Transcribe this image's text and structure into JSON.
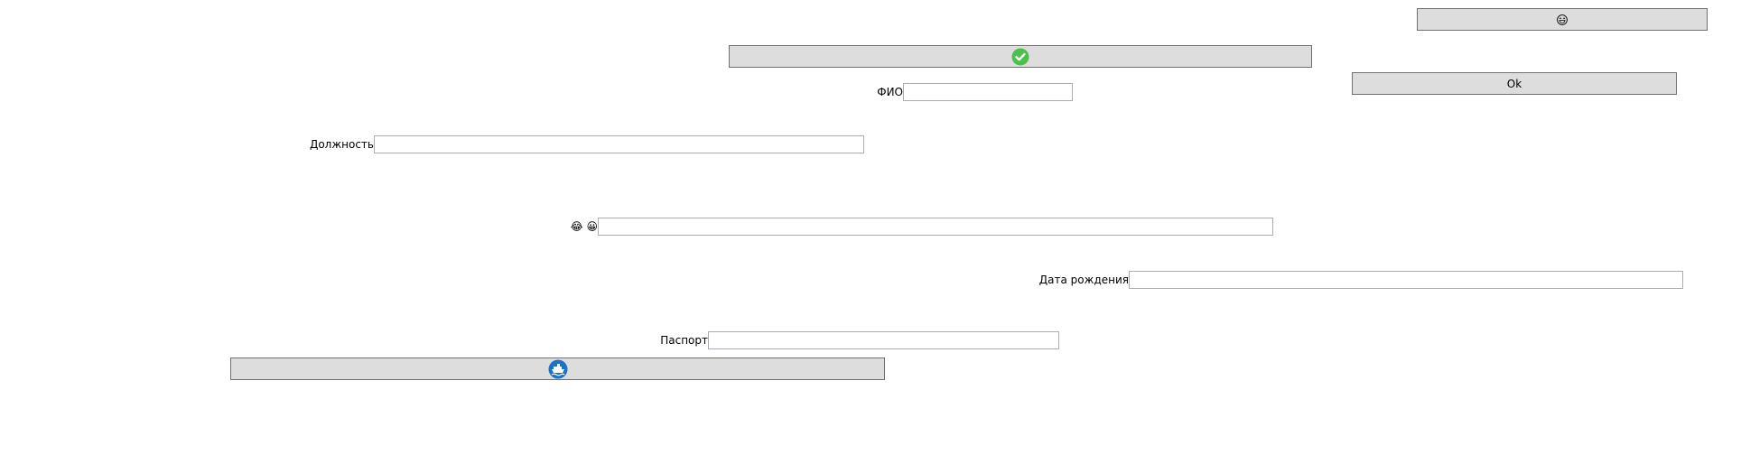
{
  "buttons": {
    "top_right_emoji": "😂",
    "confirm_icon": "check-circle",
    "ok_label": "Ok",
    "ship_icon": "ship"
  },
  "fields": {
    "fio_label": "ФИО",
    "fio_value": "",
    "position_label": "Должность",
    "position_value": "",
    "emoji_label": "😂 😀",
    "emoji_value": "",
    "birthdate_label": "Дата рождения",
    "birthdate_value": "",
    "passport_label": "Паспорт",
    "passport_value": ""
  },
  "colors": {
    "button_bg": "#dddddd",
    "button_border": "#707070",
    "check_green": "#4cbf4c",
    "ship_blue": "#1a73c8",
    "input_border": "#abadb3"
  }
}
